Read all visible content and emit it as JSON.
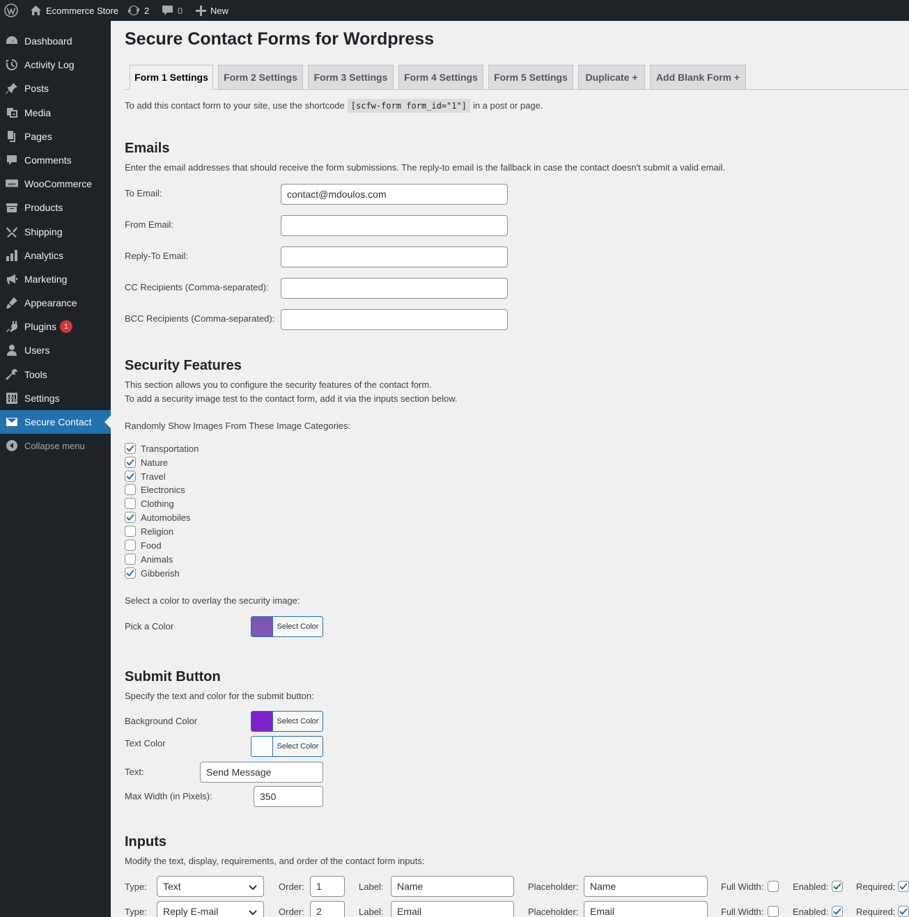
{
  "adminbar": {
    "site_name": "Ecommerce Store",
    "updates_count": "2",
    "comments_count": "0",
    "new_label": "New"
  },
  "sidebar": {
    "items": [
      {
        "label": "Dashboard",
        "icon": "dashboard-icon"
      },
      {
        "label": "Activity Log",
        "icon": "history-icon"
      },
      {
        "label": "Posts",
        "icon": "pin-icon"
      },
      {
        "label": "Media",
        "icon": "media-icon"
      },
      {
        "label": "Pages",
        "icon": "pages-icon"
      },
      {
        "label": "Comments",
        "icon": "comment-icon"
      },
      {
        "label": "WooCommerce",
        "icon": "woo-icon"
      },
      {
        "label": "Products",
        "icon": "archive-icon"
      },
      {
        "label": "Shipping",
        "icon": "shipping-icon"
      },
      {
        "label": "Analytics",
        "icon": "chart-icon"
      },
      {
        "label": "Marketing",
        "icon": "megaphone-icon"
      },
      {
        "label": "Appearance",
        "icon": "brush-icon"
      },
      {
        "label": "Plugins",
        "icon": "plugin-icon",
        "badge": "1"
      },
      {
        "label": "Users",
        "icon": "user-icon"
      },
      {
        "label": "Tools",
        "icon": "wrench-icon"
      },
      {
        "label": "Settings",
        "icon": "settings-icon"
      },
      {
        "label": "Secure Contact",
        "icon": "email-icon",
        "current": true
      }
    ],
    "collapse_label": "Collapse menu"
  },
  "page": {
    "title": "Secure Contact Forms for Wordpress",
    "tabs": [
      "Form 1 Settings",
      "Form 2 Settings",
      "Form 3 Settings",
      "Form 4 Settings",
      "Form 5 Settings",
      "Duplicate +",
      "Add Blank Form +"
    ],
    "shortcode_prefix": "To add this contact form to your site, use the shortcode",
    "shortcode": "[scfw-form form_id=\"1\"]",
    "shortcode_suffix": "in a post or page."
  },
  "emails": {
    "heading": "Emails",
    "description": "Enter the email addresses that should receive the form submissions. The reply-to email is the fallback in case the contact doesn't submit a valid email.",
    "fields": [
      {
        "label": "To Email:",
        "value": "contact@mdoulos.com"
      },
      {
        "label": "From Email:",
        "value": ""
      },
      {
        "label": "Reply-To Email:",
        "value": ""
      },
      {
        "label": "CC Recipients (Comma-separated):",
        "value": ""
      },
      {
        "label": "BCC Recipients (Comma-separated):",
        "value": ""
      }
    ]
  },
  "security": {
    "heading": "Security Features",
    "desc1": "This section allows you to configure the security features of the contact form.",
    "desc2": "To add a security image test to the contact form, add it via the inputs section below.",
    "categories_label": "Randomly Show Images From These Image Categories:",
    "categories": [
      {
        "label": "Transportation",
        "checked": true
      },
      {
        "label": "Nature",
        "checked": true
      },
      {
        "label": "Travel",
        "checked": true
      },
      {
        "label": "Electronics",
        "checked": false
      },
      {
        "label": "Clothing",
        "checked": false
      },
      {
        "label": "Automobiles",
        "checked": true
      },
      {
        "label": "Religion",
        "checked": false
      },
      {
        "label": "Food",
        "checked": false
      },
      {
        "label": "Animals",
        "checked": false
      },
      {
        "label": "Gibberish",
        "checked": true
      }
    ],
    "overlay_label": "Select a color to overlay the security image:",
    "pick_label": "Pick a Color",
    "overlay_color": "#7f54b3",
    "select_color_label": "Select Color"
  },
  "submit": {
    "heading": "Submit Button",
    "description": "Specify the text and color for the submit button:",
    "bg_label": "Background Color",
    "bg_color": "#7e22ce",
    "text_color_label": "Text Color",
    "text_color": "#ffffff",
    "select_color_label": "Select Color",
    "text_label": "Text:",
    "text_value": "Send Message",
    "maxwidth_label": "Max Width (in Pixels):",
    "maxwidth_value": "350"
  },
  "inputs": {
    "heading": "Inputs",
    "description": "Modify the text, display, requirements, and order of the contact form inputs:",
    "type_label": "Type:",
    "order_label": "Order:",
    "label_label": "Label:",
    "placeholder_label": "Placeholder:",
    "fullwidth_label": "Full Width:",
    "enabled_label": "Enabled:",
    "required_label": "Required:",
    "rows": [
      {
        "type": "Text",
        "order": "1",
        "label": "Name",
        "placeholder": "Name",
        "full_width": false,
        "enabled": true,
        "required": true
      },
      {
        "type": "Reply E-mail",
        "order": "2",
        "label": "Email",
        "placeholder": "Email",
        "full_width": false,
        "enabled": true,
        "required": true
      }
    ]
  }
}
